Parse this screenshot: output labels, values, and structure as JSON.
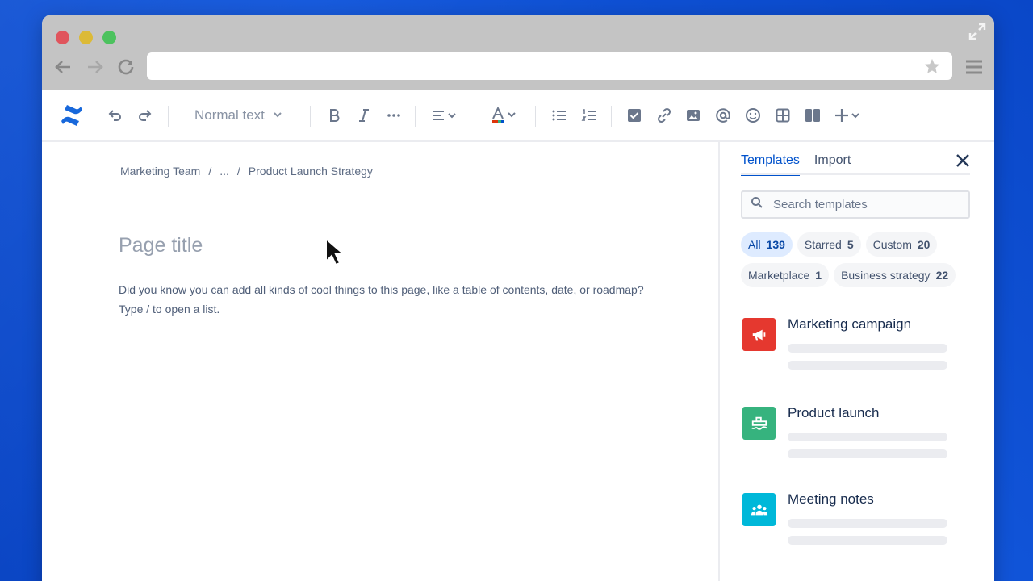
{
  "browser": {
    "url": "",
    "icons": [
      "back-arrow-icon",
      "forward-arrow-icon",
      "reload-icon",
      "star-icon",
      "hamburger-menu-icon",
      "expand-icon"
    ]
  },
  "toolbar": {
    "text_style": "Normal text",
    "icons": [
      "undo-icon",
      "redo-icon",
      "bold-icon",
      "italic-icon",
      "more-icon",
      "align-icon",
      "text-color-icon",
      "bullet-list-icon",
      "numbered-list-icon",
      "checkbox-icon",
      "link-icon",
      "image-icon",
      "mention-icon",
      "emoji-icon",
      "table-icon",
      "layout-icon",
      "insert-plus-icon"
    ],
    "text_color_accent": "#de350b"
  },
  "breadcrumb": {
    "space": "Marketing Team",
    "separator": "/",
    "ellipsis": "...",
    "current": "Product Launch Strategy"
  },
  "editor": {
    "title_placeholder": "Page title",
    "hint_line1": "Did you know you can add all kinds of cool things to this page, like a table of contents, date, or roadmap?",
    "hint_line2": "Type / to open a list."
  },
  "panel": {
    "tabs": [
      {
        "label": "Templates",
        "active": true
      },
      {
        "label": "Import",
        "active": false
      }
    ],
    "search_placeholder": "Search templates",
    "filters": [
      {
        "label": "All",
        "count": "139",
        "active": true
      },
      {
        "label": "Starred",
        "count": "5",
        "active": false
      },
      {
        "label": "Custom",
        "count": "20",
        "active": false
      },
      {
        "label": "Marketplace",
        "count": "1",
        "active": false
      },
      {
        "label": "Business strategy",
        "count": "22",
        "active": false
      }
    ],
    "templates": [
      {
        "title": "Marketing campaign",
        "color": "#e5382f",
        "icon": "megaphone-icon"
      },
      {
        "title": "Product launch",
        "color": "#36b37e",
        "icon": "ship-icon"
      },
      {
        "title": "Meeting notes",
        "color": "#00b8d9",
        "icon": "people-icon"
      }
    ]
  },
  "colors": {
    "background": "#0b4fd1",
    "accent": "#0052cc",
    "chrome": "#c4c4c4"
  }
}
